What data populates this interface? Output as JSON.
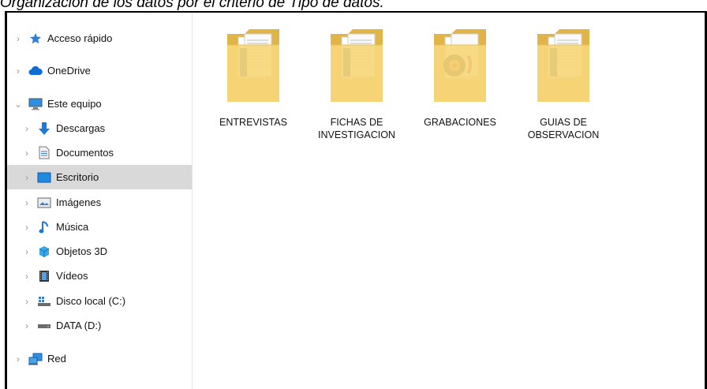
{
  "caption": "Organización de los datos por el criterio de Tipo de datos.",
  "nav": {
    "items": [
      {
        "label": "Acceso rápido",
        "icon": "star-icon"
      },
      {
        "label": "OneDrive",
        "icon": "cloud-icon"
      },
      {
        "label": "Este equipo",
        "icon": "computer-icon"
      },
      {
        "label": "Descargas",
        "icon": "download-arrow-icon"
      },
      {
        "label": "Documentos",
        "icon": "document-icon"
      },
      {
        "label": "Escritorio",
        "icon": "desktop-icon",
        "selected": true
      },
      {
        "label": "Imágenes",
        "icon": "image-icon"
      },
      {
        "label": "Música",
        "icon": "music-note-icon"
      },
      {
        "label": "Objetos 3D",
        "icon": "cube-3d-icon"
      },
      {
        "label": "Vídeos",
        "icon": "film-icon"
      },
      {
        "label": "Disco local (C:)",
        "icon": "local-disk-icon"
      },
      {
        "label": "DATA (D:)",
        "icon": "drive-icon"
      },
      {
        "label": "Red",
        "icon": "network-icon"
      }
    ]
  },
  "folders": [
    {
      "label": "ENTREVISTAS",
      "icon": "folder-document-icon"
    },
    {
      "label": "FICHAS DE\nINVESTIGACION",
      "icon": "folder-document-icon"
    },
    {
      "label": "GRABACIONES",
      "icon": "folder-media-icon"
    },
    {
      "label": "GUIAS DE\nOBSERVACION",
      "icon": "folder-document-icon"
    }
  ],
  "colors": {
    "selected_bg": "#d9d9d9",
    "folder_yellow": "#f7d77a",
    "folder_dark": "#e0b446"
  }
}
